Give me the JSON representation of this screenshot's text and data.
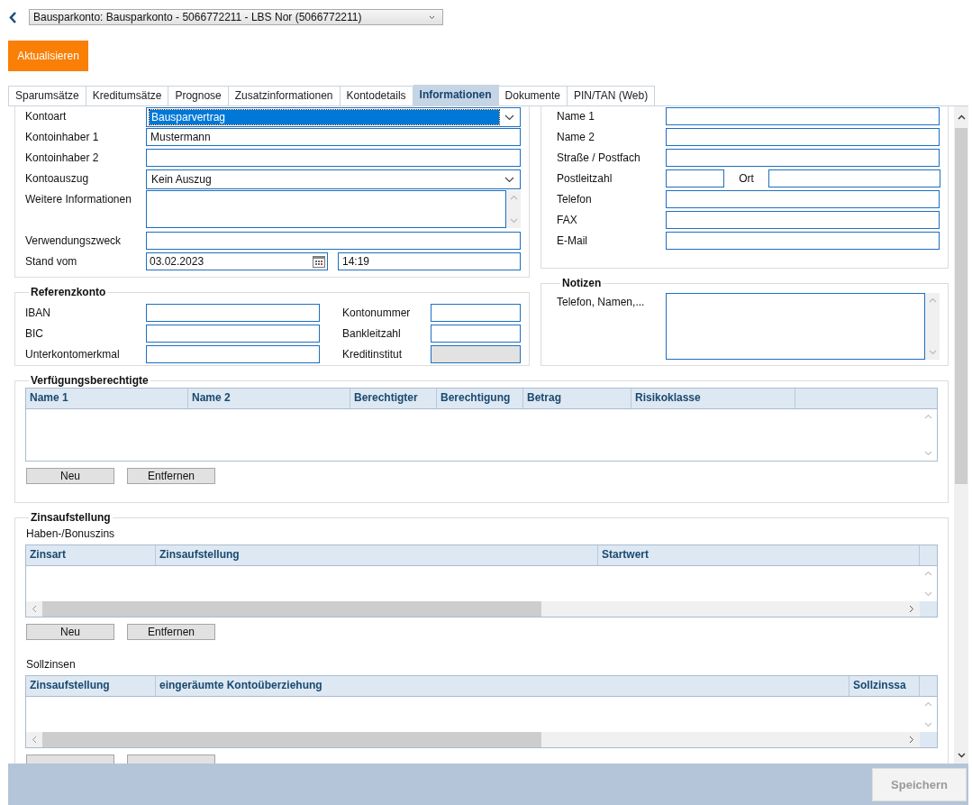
{
  "account_select": {
    "value": "Bausparkonto: Bausparkonto - 5066772211 - LBS Nor (5066772211)"
  },
  "refresh_button": "Aktualisieren",
  "tabs": [
    {
      "label": "Sparumsätze",
      "selected": false
    },
    {
      "label": "Kreditumsätze",
      "selected": false
    },
    {
      "label": "Prognose",
      "selected": false
    },
    {
      "label": "Zusatzinformationen",
      "selected": false
    },
    {
      "label": "Kontodetails",
      "selected": false
    },
    {
      "label": "Informationen",
      "selected": true
    },
    {
      "label": "Dokumente",
      "selected": false
    },
    {
      "label": "PIN/TAN (Web)",
      "selected": false
    }
  ],
  "account_fields": [
    {
      "label": "Kontoart",
      "kind": "select",
      "value": "Bausparvertrag",
      "focused": true
    },
    {
      "label": "Kontoinhaber 1",
      "kind": "text",
      "value": "Mustermann"
    },
    {
      "label": "Kontoinhaber 2",
      "kind": "text"
    },
    {
      "label": "Kontoauszug",
      "kind": "select",
      "value": "Kein Auszug",
      "focused": false
    },
    {
      "label": "Weitere Informationen",
      "kind": "textarea"
    },
    {
      "label": "Verwendungszweck",
      "kind": "text"
    },
    {
      "label": "Stand vom",
      "kind": "datetime",
      "date": "03.02.2023",
      "time": "14:19"
    }
  ],
  "contact_fields": [
    {
      "label": "Name 1",
      "kind": "text"
    },
    {
      "label": "Name 2",
      "kind": "text"
    },
    {
      "label": "Straße / Postfach",
      "kind": "text"
    },
    {
      "label": "Postleitzahl",
      "kind": "zip_city",
      "second_label": "Ort"
    },
    {
      "label": "Telefon",
      "kind": "text"
    },
    {
      "label": "FAX",
      "kind": "text"
    },
    {
      "label": "E-Mail",
      "kind": "text"
    }
  ],
  "reference_account": {
    "title": "Referenzkonto",
    "rows": [
      {
        "label": "IBAN",
        "label_2": "Kontonummer",
        "disabled_2": false
      },
      {
        "label": "BIC",
        "label_2": "Bankleitzahl",
        "disabled_2": false
      },
      {
        "label": "Unterkontomerkmal",
        "label_2": "Kreditinstitut",
        "disabled_2": true
      }
    ]
  },
  "notes": {
    "title": "Notizen",
    "label": "Telefon, Namen,..."
  },
  "authorized": {
    "title": "Verfügungsberechtigte",
    "columns": [
      "Name 1",
      "Name 2",
      "Berechtigter",
      "Berechtigung",
      "Betrag",
      "Risikoklasse"
    ],
    "buttons": [
      "Neu",
      "Entfernen"
    ]
  },
  "interest": {
    "title": "Zinsaufstellung",
    "sections": [
      {
        "label": "Haben-/Bonuszins",
        "columns": [
          "Zinsart",
          "Zinsaufstellung",
          "Startwert"
        ],
        "buttons": [
          "Neu",
          "Entfernen"
        ]
      },
      {
        "label": "Sollzinsen",
        "columns": [
          "Zinsaufstellung",
          "eingeräumte Kontoüberziehung",
          "Sollzinssa"
        ]
      }
    ]
  },
  "save_button": {
    "label": "Speichern",
    "disabled": true
  }
}
